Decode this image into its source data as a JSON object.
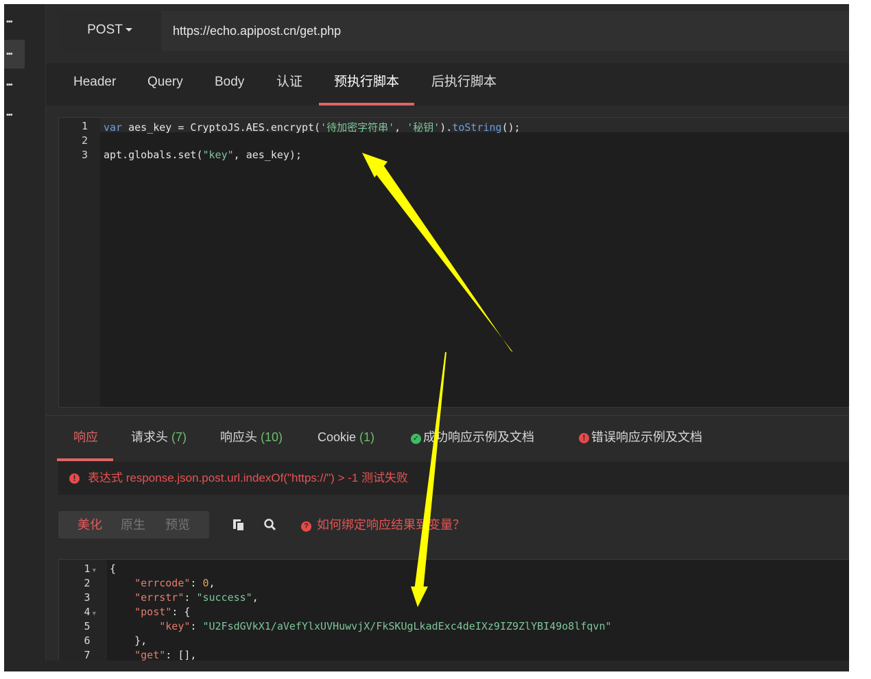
{
  "request": {
    "method": "POST",
    "url": "https://echo.apipost.cn/get.php"
  },
  "request_tabs": [
    "Header",
    "Query",
    "Body",
    "认证",
    "预执行脚本",
    "后执行脚本"
  ],
  "active_request_tab": "预执行脚本",
  "script_editor": {
    "line_numbers": [
      "1",
      "2",
      "3"
    ],
    "line1": {
      "kw": "var",
      "mid": " aes_key = CryptoJS.AES.encrypt(",
      "arg1": "'待加密字符串'",
      "comma": ", ",
      "arg2": "'秘钥'",
      "close": ").",
      "fn": "toString",
      "end": "();"
    },
    "line3": {
      "pre": "apt.globals.set(",
      "arg": "\"key\"",
      "post": ", aes_key);"
    }
  },
  "response_tabs": {
    "response": "响应",
    "req_headers": "请求头",
    "req_headers_count": "(7)",
    "resp_headers": "响应头",
    "resp_headers_count": "(10)",
    "cookie": "Cookie",
    "cookie_count": "(1)",
    "success_example": "成功响应示例及文档",
    "error_example": "错误响应示例及文档"
  },
  "assertion_message": "表达式 response.json.post.url.indexOf(\"https://\") > -1 测试失败",
  "view_modes": [
    "美化",
    "原生",
    "预览"
  ],
  "active_view_mode": "美化",
  "help_link": "如何绑定响应结果到变量？",
  "response_body": {
    "line_numbers": [
      "1",
      "2",
      "3",
      "4",
      "5",
      "6",
      "7"
    ],
    "lines": [
      {
        "text": "{"
      },
      {
        "key": "\"errcode\"",
        "sep": ": ",
        "num": "0",
        "tail": ","
      },
      {
        "key": "\"errstr\"",
        "sep": ": ",
        "str": "\"success\"",
        "tail": ","
      },
      {
        "key": "\"post\"",
        "sep": ": ",
        "tail": "{"
      },
      {
        "key": "\"key\"",
        "sep": ": ",
        "str": "\"U2FsdGVkX1/aVefYlxUVHuwvjX/FkSKUgLkadExc4deIXz9IZ9ZlYBI49o8lfqvn\""
      },
      {
        "text": "},"
      },
      {
        "key": "\"get\"",
        "sep": ": ",
        "tail": "[],"
      }
    ]
  },
  "colors": {
    "accent": "#e06464",
    "background": "#2b2b2b",
    "arrow": "#ffff00"
  }
}
